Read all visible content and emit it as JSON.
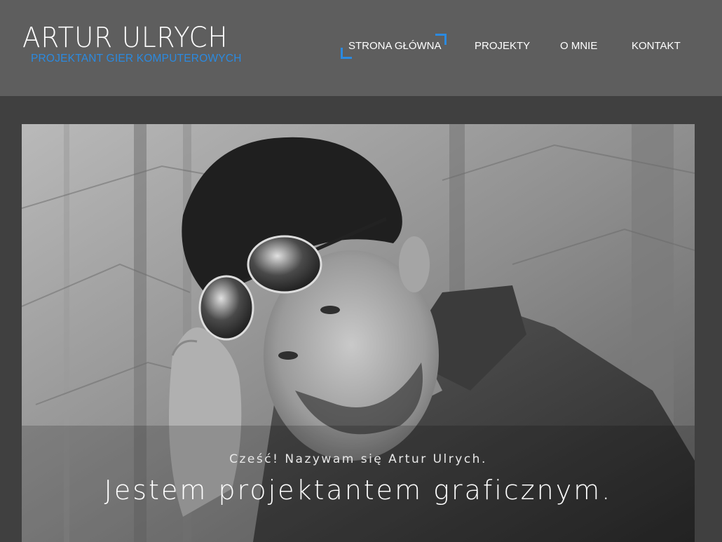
{
  "site": {
    "name": "ARTUR ULRYCH",
    "tagline": "PROJEKTANT GIER KOMPUTEROWYCH"
  },
  "nav": {
    "items": [
      {
        "label": "STRONA GŁÓWNA",
        "active": true
      },
      {
        "label": "PROJEKTY",
        "active": false
      },
      {
        "label": "O MNIE",
        "active": false
      },
      {
        "label": "KONTAKT",
        "active": false
      }
    ]
  },
  "hero": {
    "greeting": "Cześć! Nazywam się Artur Ulrych.",
    "headline": "Jestem projektantem graficznym."
  },
  "colors": {
    "accent": "#2b8ae0",
    "header_bg": "#5e5e5e",
    "page_bg": "#404040"
  }
}
